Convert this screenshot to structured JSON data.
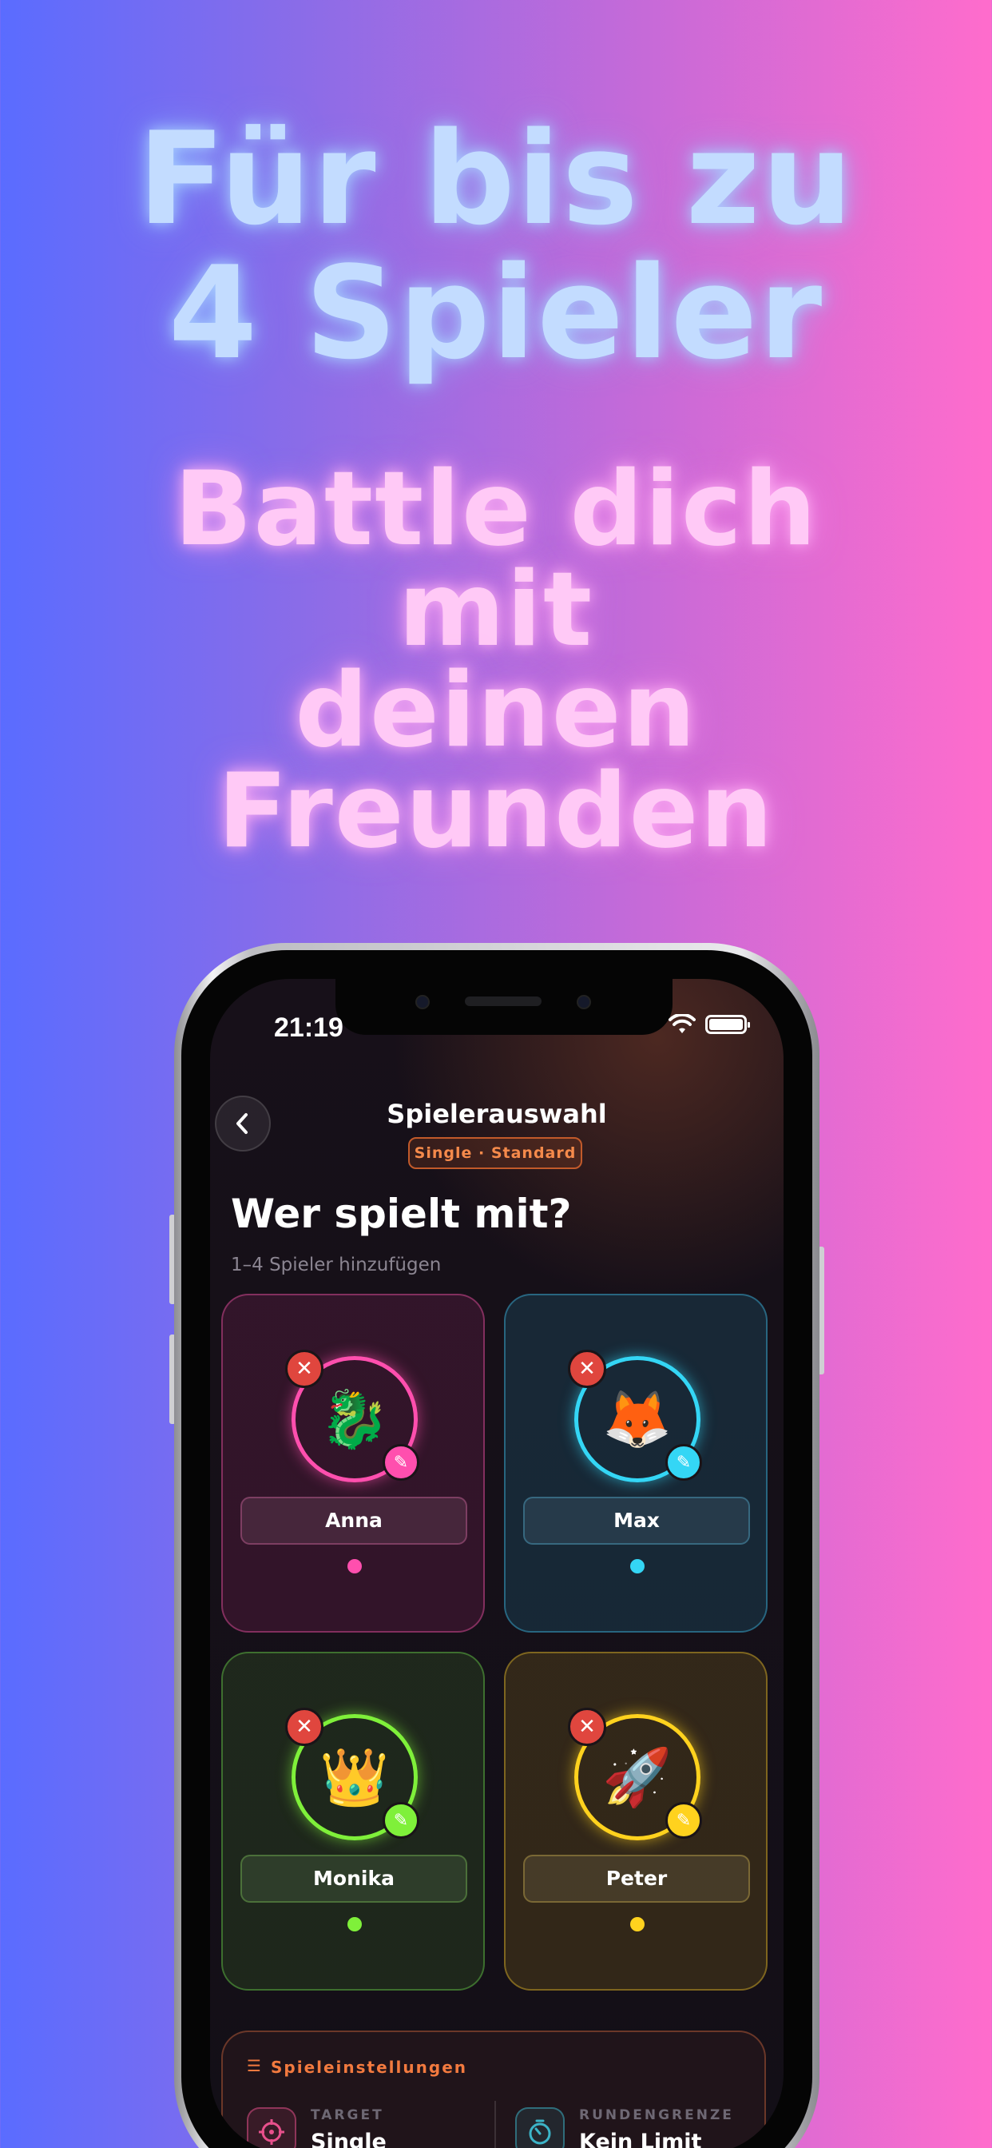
{
  "headline": {
    "line1": "Für bis zu",
    "line2": "4 Spieler",
    "sub_line1": "Battle dich",
    "sub_line2": "mit",
    "sub_line3": "deinen",
    "sub_line4": "Freunden"
  },
  "status_bar": {
    "time": "21:19",
    "icons": [
      "wifi-icon",
      "battery-icon"
    ]
  },
  "nav": {
    "back_icon": "chevron-left-icon",
    "title": "Spielerauswahl",
    "badge": "Single · Standard"
  },
  "page": {
    "title": "Wer spielt mit?",
    "subtitle": "1–4 Spieler hinzufügen"
  },
  "players": [
    {
      "name": "Anna",
      "avatar": "🐉",
      "color": "#ff4fae"
    },
    {
      "name": "Max",
      "avatar": "🦊",
      "color": "#34d6f5"
    },
    {
      "name": "Monika",
      "avatar": "👑",
      "color": "#7ff03a"
    },
    {
      "name": "Peter",
      "avatar": "🚀",
      "color": "#ffd21e"
    }
  ],
  "settings": {
    "title": "Spieleinstellungen",
    "target_label": "TARGET",
    "target_value": "Single",
    "round_label": "RUNDENGRENZE",
    "round_value": "Kein Limit"
  },
  "colors": {
    "background_left": "#5a6cff",
    "background_right": "#ff6ccc",
    "headline_blue": "#c3dcff",
    "headline_pink": "#ffc9f6",
    "accent_orange": "#f27a3f",
    "remove_red": "#e0463e"
  }
}
